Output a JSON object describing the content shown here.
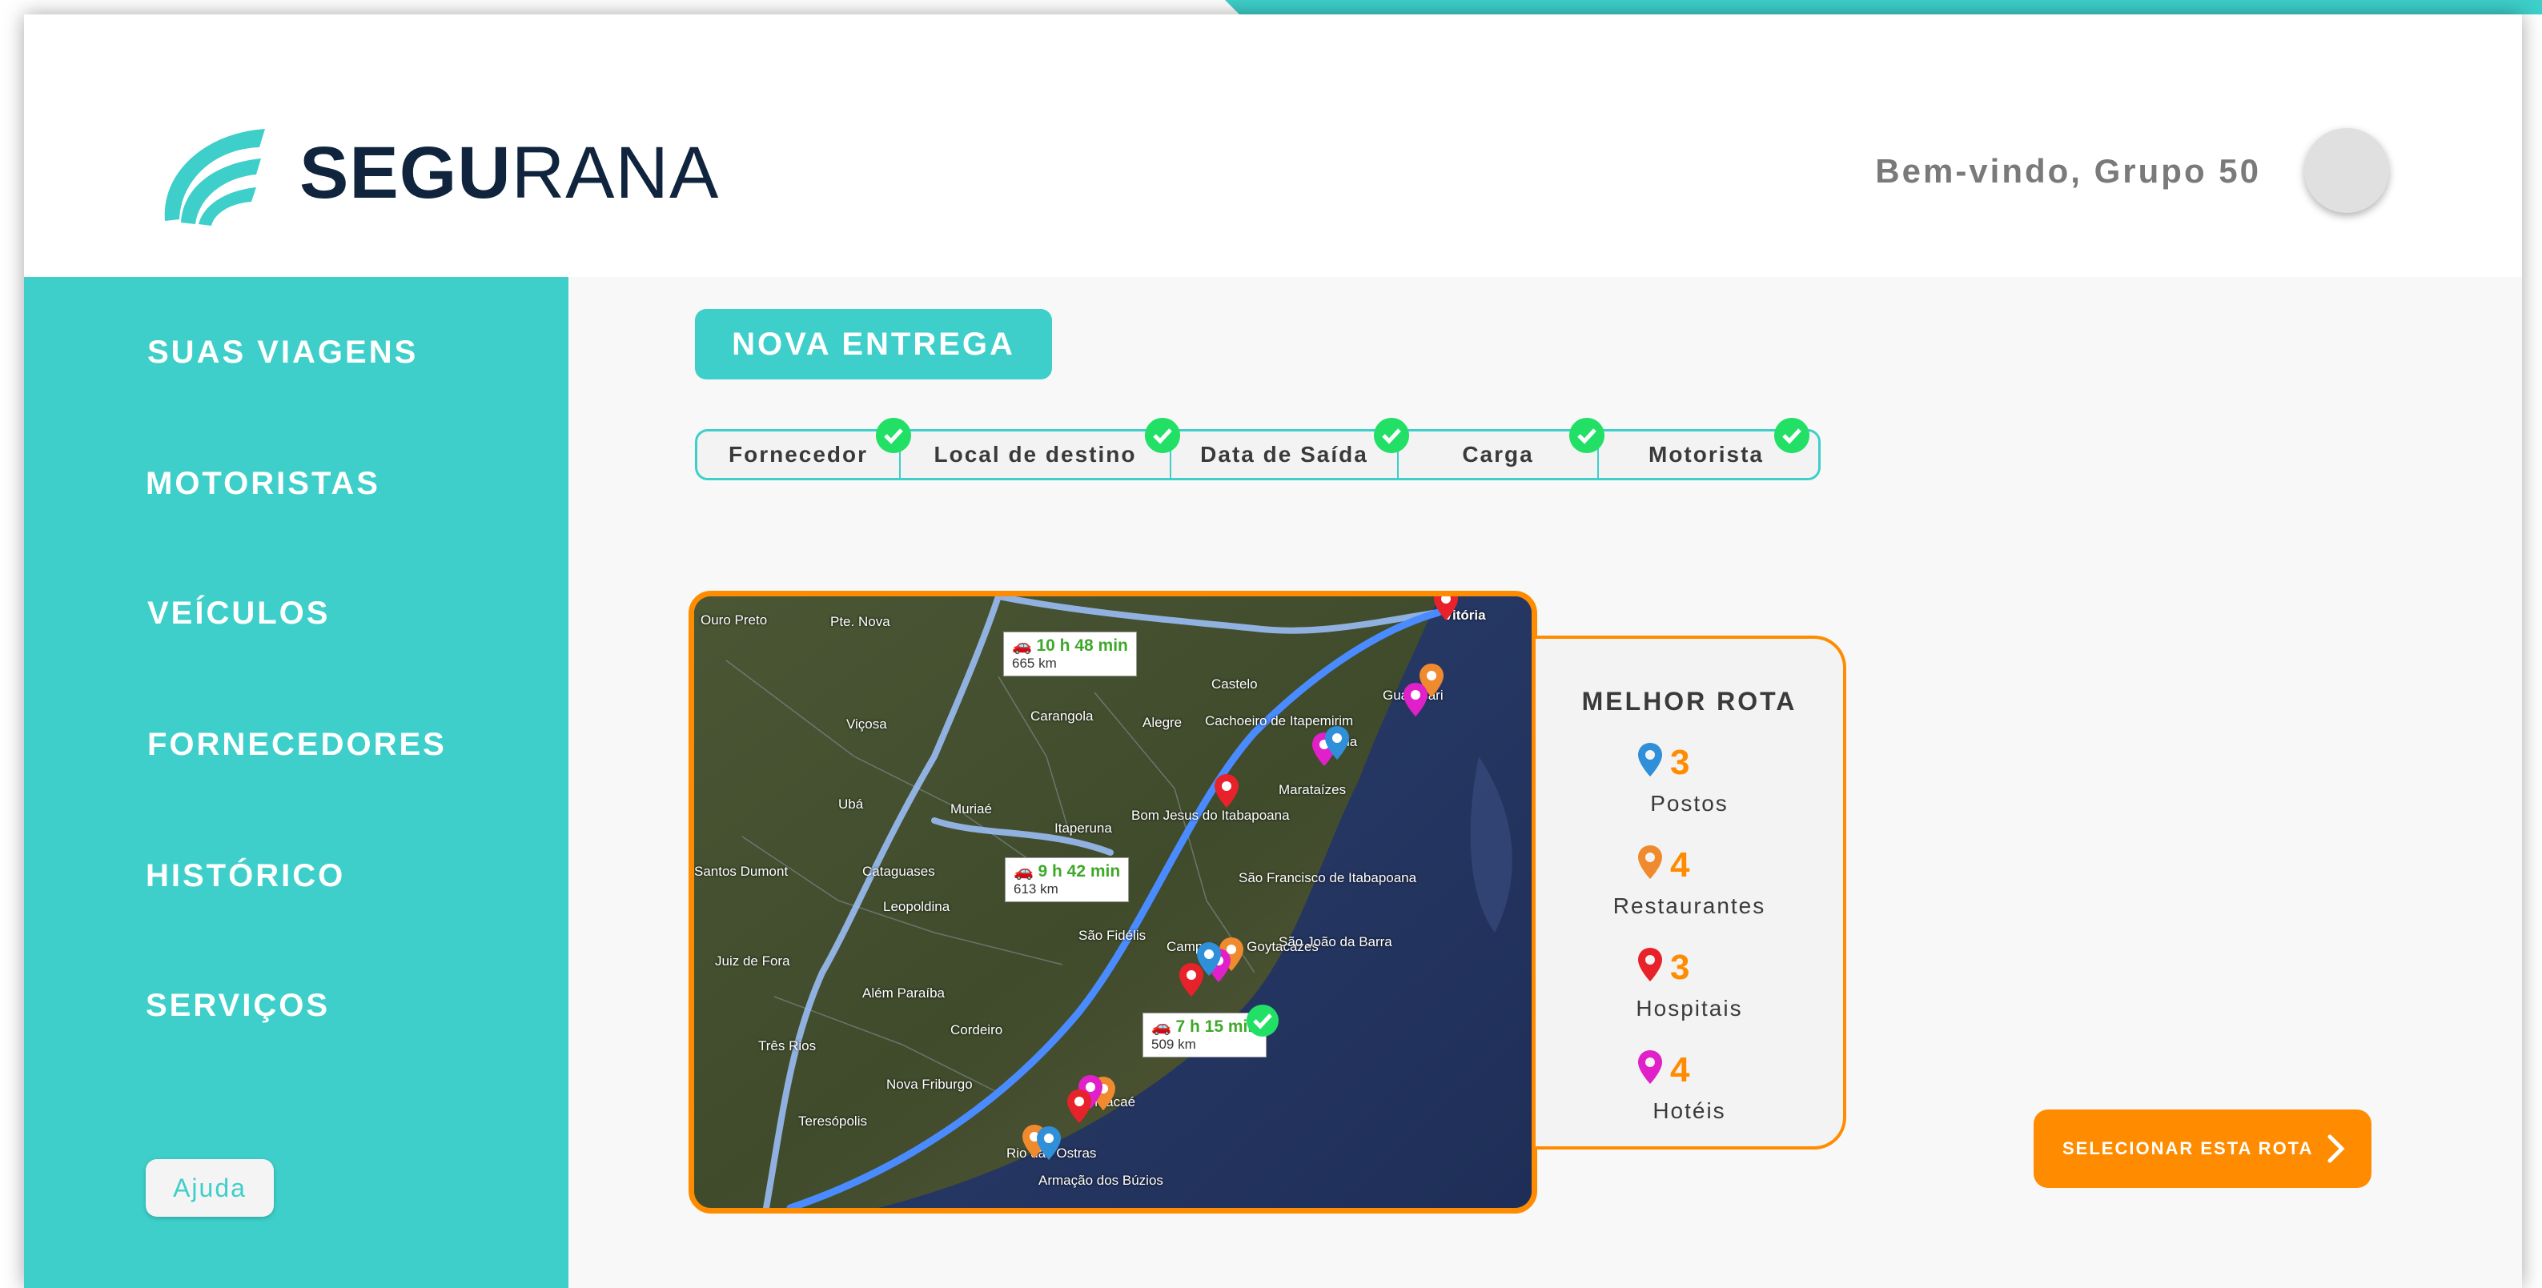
{
  "brand": {
    "name_bold": "SEGU",
    "name_light": "RANA"
  },
  "header": {
    "welcome": "Bem-vindo, Grupo 50"
  },
  "sidebar": {
    "items": [
      {
        "label": "SUAS VIAGENS"
      },
      {
        "label": "MOTORISTAS"
      },
      {
        "label": "VEÍCULOS"
      },
      {
        "label": "FORNECEDORES"
      },
      {
        "label": "HISTÓRICO"
      },
      {
        "label": "SERVIÇOS"
      }
    ],
    "help_label": "Ajuda"
  },
  "main": {
    "new_delivery_label": "NOVA ENTREGA",
    "steps": [
      {
        "label": "Fornecedor",
        "done": true
      },
      {
        "label": "Local de destino",
        "done": true
      },
      {
        "label": "Data de Saída",
        "done": true
      },
      {
        "label": "Carga",
        "done": true
      },
      {
        "label": "Motorista",
        "done": true
      }
    ],
    "map": {
      "routes": [
        {
          "time": "10 h 48 min",
          "distance": "665 km"
        },
        {
          "time": "9 h 42 min",
          "distance": "613 km"
        },
        {
          "time": "7 h 15 min",
          "distance": "509 km"
        }
      ],
      "places": [
        "Ouro Preto",
        "Pte. Nova",
        "Viçosa",
        "Carangola",
        "Alegre",
        "Cachoeiro de Itapemirim",
        "Castelo",
        "Vitória",
        "Guarapari",
        "Piúma",
        "Marataízes",
        "Ubá",
        "Muriaé",
        "Itaperuna",
        "Bom Jesus do Itabapoana",
        "São Francisco de Itabapoana",
        "Cataguases",
        "Leopoldina",
        "São Fidélis",
        "Campos dos Goytacazes",
        "São João da Barra",
        "Juiz de Fora",
        "Além Paraíba",
        "Cordeiro",
        "Três Rios",
        "Nova Friburgo",
        "Macaé",
        "Teresópolis",
        "Rio das Ostras",
        "Armação dos Búzios",
        "Santos Dumont"
      ],
      "selected_route_index": 2
    },
    "best_route": {
      "title": "MELHOR ROTA",
      "items": [
        {
          "count": "3",
          "label": "Postos",
          "color": "#2f8fd8"
        },
        {
          "count": "4",
          "label": "Restaurantes",
          "color": "#f08a2e"
        },
        {
          "count": "3",
          "label": "Hospitais",
          "color": "#e8222a"
        },
        {
          "count": "4",
          "label": "Hotéis",
          "color": "#e020c8"
        }
      ]
    },
    "select_route_label": "SELECIONAR ESTA ROTA"
  },
  "colors": {
    "teal": "#3ecfca",
    "orange": "#ff8c00",
    "check_green": "#22e066",
    "navy": "#10253d"
  }
}
